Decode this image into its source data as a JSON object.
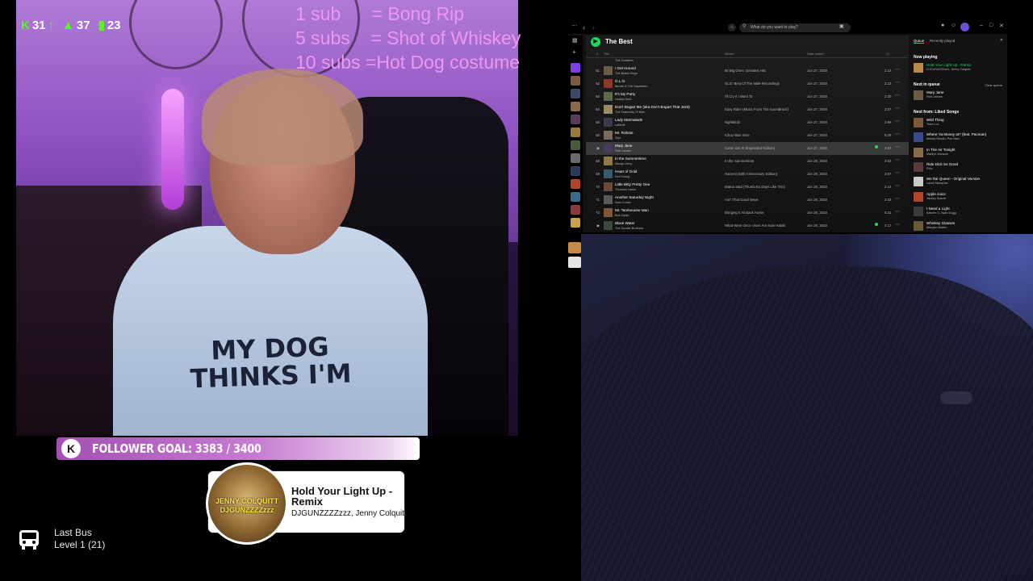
{
  "stream": {
    "stats": {
      "kick_viewers": "31",
      "followers_up": "37",
      "bars_count": "23"
    },
    "sub_goals": [
      "1 sub      = Bong Rip",
      "5 subs    = Shot of Whiskey",
      "10 subs =Hot Dog costume"
    ],
    "shirt_text": [
      "MY DOG",
      "THINKS I'M"
    ],
    "follower_goal": {
      "logo": "K",
      "text": "FOLLOWER GOAL: 3383 / 3400"
    },
    "now_playing": {
      "title": "Hold Your Light Up - Remix",
      "artist": "DJGUNZZZZzzz, Jenny Colquitt",
      "art_line1": "JENNY COLQUITT",
      "art_line2": "DJGUNZZZZzzz"
    },
    "last_bus": {
      "label": "Last Bus",
      "level": "Level 1  (21)"
    }
  },
  "spotify": {
    "search_placeholder": "What do you want to play?",
    "playlist_title": "The Best",
    "columns": {
      "num": "#",
      "title": "Title",
      "album": "Album",
      "date": "Date added",
      "duration": "◷"
    },
    "rows": [
      {
        "num": "",
        "title": "",
        "artist": "The Coasters",
        "album": "",
        "date": "",
        "duration": "",
        "liked": false,
        "selected": false
      },
      {
        "num": "61",
        "title": "I Get Around",
        "artist": "The Beach Boys",
        "album": "50 Big Ones: Greatest Hits",
        "date": "Jun 27, 2020",
        "duration": "2:14",
        "liked": false,
        "selected": false
      },
      {
        "num": "62",
        "title": "G.L.O.",
        "artist": "Bernie & The Daymares",
        "album": "GLO: Best Of The Male Recordings",
        "date": "Jun 27, 2020",
        "duration": "2:23",
        "liked": false,
        "selected": false
      },
      {
        "num": "63",
        "title": "It's My Party",
        "artist": "Lesley Gore",
        "album": "I'll Cry If I Want To",
        "date": "Jun 27, 2020",
        "duration": "2:20",
        "liked": false,
        "selected": false
      },
      {
        "num": "64",
        "title": "Don't Bogart Me (aka Don't Bogart That Joint)",
        "artist": "The Fraternity Of Man",
        "album": "Easy Rider (Music From The Soundtrack)",
        "date": "Jun 27, 2020",
        "duration": "3:07",
        "liked": false,
        "selected": false
      },
      {
        "num": "65",
        "title": "Lady Marmalade",
        "artist": "LaBelle",
        "album": "Nightbirds",
        "date": "Jun 27, 2020",
        "duration": "3:56",
        "liked": false,
        "selected": false
      },
      {
        "num": "66",
        "title": "Mr. Roboto",
        "artist": "Styx",
        "album": "Kilroy Was Here",
        "date": "Jun 27, 2020",
        "duration": "5:29",
        "liked": false,
        "selected": false
      },
      {
        "num": "▶",
        "title": "Mary Jane",
        "artist": "Rick James",
        "album": "Come Get It! (Expanded Edition)",
        "date": "Jun 27, 2020",
        "duration": "4:57",
        "liked": true,
        "selected": true
      },
      {
        "num": "68",
        "title": "In the Summertime",
        "artist": "Mungo Jerry",
        "album": "In the Summertime",
        "date": "Jun 28, 2020",
        "duration": "3:32",
        "liked": false,
        "selected": false
      },
      {
        "num": "69",
        "title": "Heart of Gold",
        "artist": "Neil Young",
        "album": "Harvest (50th Anniversary Edition)",
        "date": "Jun 28, 2020",
        "duration": "3:07",
        "liked": false,
        "selected": false
      },
      {
        "num": "70",
        "title": "Little Bitty Pretty One",
        "artist": "Thurston Harris",
        "album": "Mama Said (Thumb Bo Days Like This)",
        "date": "Jun 28, 2020",
        "duration": "2:14",
        "liked": false,
        "selected": false
      },
      {
        "num": "71",
        "title": "Another Saturday Night",
        "artist": "Sam Cooke",
        "album": "Ain't That Good News",
        "date": "Jun 28, 2020",
        "duration": "2:43",
        "liked": false,
        "selected": false
      },
      {
        "num": "72",
        "title": "Mr. Tambourine Man",
        "artist": "Bob Dylan",
        "album": "Bringing It All Back Home",
        "date": "Jun 28, 2020",
        "duration": "5:31",
        "liked": false,
        "selected": false
      },
      {
        "num": "▶",
        "title": "Black Water",
        "artist": "The Doobie Brothers",
        "album": "What Were Once Vices Are Now Habits",
        "date": "Jun 28, 2020",
        "duration": "4:17",
        "liked": true,
        "selected": false
      }
    ],
    "queue": {
      "tab_queue": "Queue",
      "tab_recent": "Recently played",
      "now_playing_label": "Now playing",
      "now_playing": {
        "title": "Hold Your Light Up - Remix",
        "artist": "DJGUNZZZZzzz, Jenny Colquitt"
      },
      "next_in_queue_label": "Next in queue",
      "clear_label": "Clear queue",
      "next_in_queue": [
        {
          "title": "Mary Jane",
          "artist": "Rick James"
        }
      ],
      "next_from_label": "Next from: Liked Songs",
      "next_from": [
        {
          "title": "Wild Thing",
          "artist": "Tone Loc"
        },
        {
          "title": "Where Ya Money at? (feat. Pacman)",
          "artist": "Money Hendo, Pac Man"
        },
        {
          "title": "In The Air Tonight",
          "artist": "Marilyn Manson"
        },
        {
          "title": "Ride Dick So Good",
          "artist": "Rico"
        },
        {
          "title": "We the Queen - Original Version",
          "artist": "Lavell Memphis"
        },
        {
          "title": "Apple Juice",
          "artist": "Jackky Sunnie"
        },
        {
          "title": "I Need a Light",
          "artist": "Warren G, Nate Dogg"
        },
        {
          "title": "Whiskey Glasses",
          "artist": "Morgan Wallen"
        }
      ]
    }
  },
  "colors": {
    "spotify_green": "#1ed760",
    "kick_green": "#53fc18",
    "sub_goal_pink": "#ee97f0",
    "goal_bar_purple": "#a34fb4"
  }
}
